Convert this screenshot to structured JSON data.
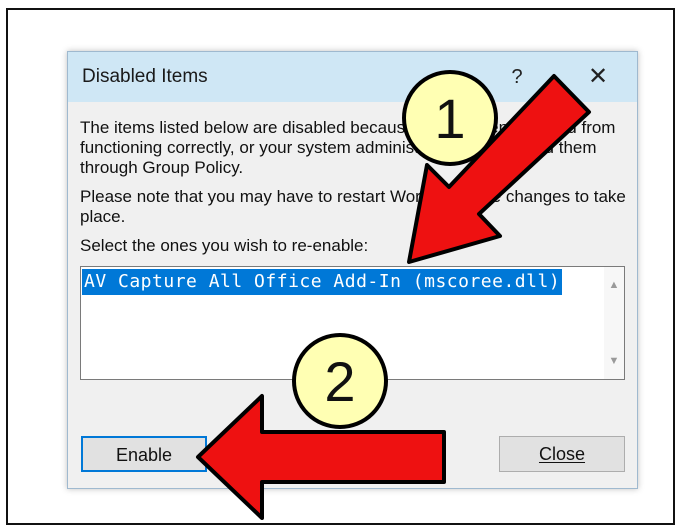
{
  "dialog": {
    "title": "Disabled Items",
    "help_label": "?",
    "close_icon_label": "✕",
    "paragraph1": "The items listed below are disabled because they prevented Word from functioning correctly, or your system administrator has disabled them through Group Policy.",
    "paragraph2": "Please note that you may have to restart Word for these changes to take place.",
    "paragraph3": "Select the ones you wish to re-enable:",
    "list_items": [
      "AV Capture All Office Add-In (mscoree.dll)"
    ],
    "selected_index": 0,
    "enable_label": "Enable",
    "close_label": "Close"
  },
  "annotations": {
    "step1": "1",
    "step2": "2"
  },
  "colors": {
    "titlebar": "#cfe7f5",
    "selection": "#0078d7",
    "arrow_red": "#ee1111",
    "badge_yellow": "#ffffb3"
  }
}
